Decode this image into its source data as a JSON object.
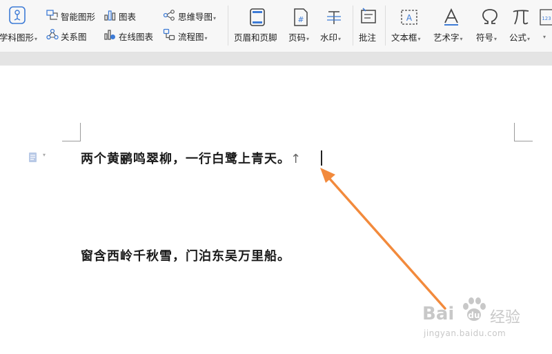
{
  "toolbar": {
    "subject_shape": "学科图形",
    "smart_shape": "智能图形",
    "chart": "图表",
    "mind_map": "思维导图",
    "relation_diagram": "关系图",
    "online_chart": "在线图表",
    "flowchart": "流程图",
    "header_footer": "页眉和页脚",
    "page_number": "页码",
    "watermark": "水印",
    "comment": "批注",
    "text_box": "文本框",
    "word_art": "艺术字",
    "symbol": "符号",
    "formula": "公式",
    "number_badge": "123"
  },
  "document": {
    "line1": "两个黄鹂鸣翠柳，一行白鹭上青天。",
    "paragraph_mark": "↑",
    "line2": "窗含西岭千秋雪，门泊东吴万里船。"
  },
  "watermark": {
    "logo_text": "Bai",
    "logo_text2": "经验",
    "url": "jingyan.baidu.com"
  },
  "colors": {
    "accent_blue": "#3d7bd6",
    "arrow": "#f28a3c",
    "watermark": "#c8c8c8"
  }
}
